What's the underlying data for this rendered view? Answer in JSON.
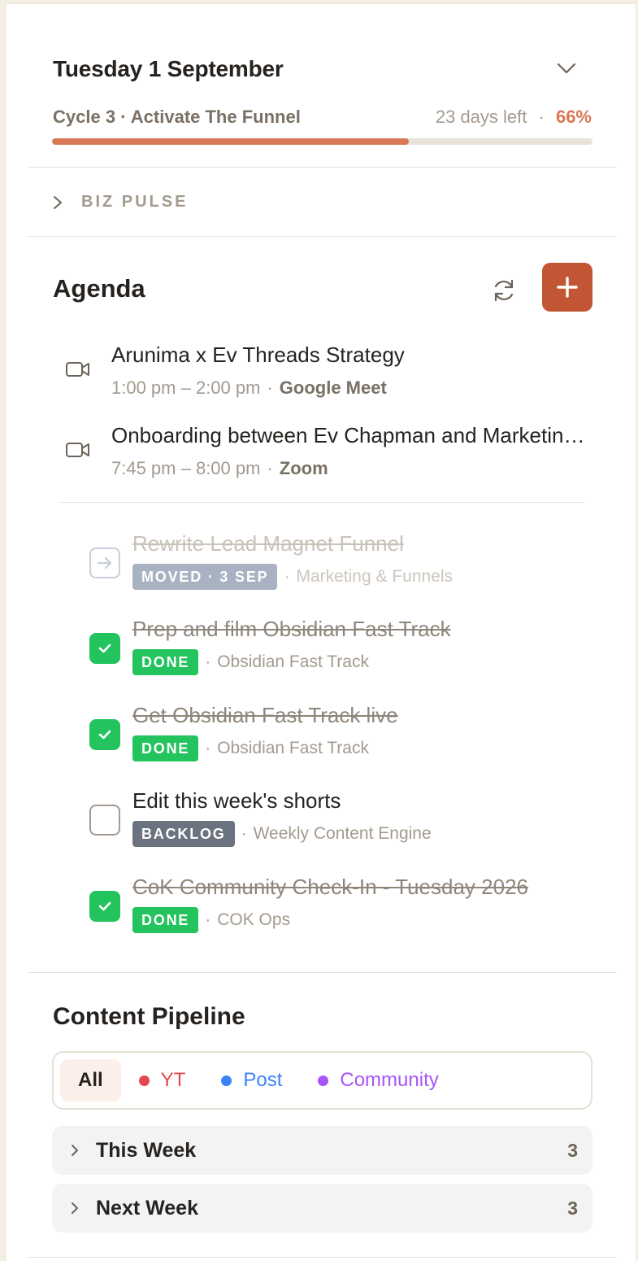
{
  "header": {
    "date": "Tuesday 1 September",
    "cycle_label": "Cycle 3 · Activate The Funnel",
    "days_left": "23 days left",
    "separator": "·",
    "percent": "66%",
    "progress_fraction": 0.66
  },
  "biz_pulse": {
    "label": "BIZ PULSE"
  },
  "agenda": {
    "title": "Agenda",
    "events": [
      {
        "title": "Arunima x Ev Threads Strategy",
        "time": "1:00 pm – 2:00 pm",
        "separator": "·",
        "location": "Google Meet"
      },
      {
        "title": "Onboarding between Ev Chapman and Marketing Team",
        "time": "7:45 pm – 8:00 pm",
        "separator": "·",
        "location": "Zoom"
      }
    ],
    "tasks": [
      {
        "title": "Rewrite Lead Magnet Funnel",
        "status": "MOVED · 3 SEP",
        "project": "Marketing & Funnels",
        "separator": "·"
      },
      {
        "title": "Prep and film Obsidian Fast Track",
        "status": "DONE",
        "project": "Obsidian Fast Track",
        "separator": "·"
      },
      {
        "title": "Get Obsidian Fast Track live",
        "status": "DONE",
        "project": "Obsidian Fast Track",
        "separator": "·"
      },
      {
        "title": "Edit this week's shorts",
        "status": "BACKLOG",
        "project": "Weekly Content Engine",
        "separator": "·"
      },
      {
        "title": "CoK Community Check-In - Tuesday 2026",
        "status": "DONE",
        "project": "COK Ops",
        "separator": "·"
      }
    ]
  },
  "content_pipeline": {
    "title": "Content Pipeline",
    "filters": [
      {
        "label": "All",
        "color": ""
      },
      {
        "label": "YT",
        "color": "#e5484d"
      },
      {
        "label": "Post",
        "color": "#3b82f6"
      },
      {
        "label": "Community",
        "color": "#a855f7"
      }
    ],
    "groups": [
      {
        "label": "This Week",
        "count": "3"
      },
      {
        "label": "Next Week",
        "count": "3"
      }
    ]
  },
  "colors": {
    "accent": "#c25634",
    "progress": "#d97a57",
    "done": "#23c35e",
    "backlog": "#6b7280",
    "moved": "#a8b2c2"
  },
  "icons": {
    "collapse": "chevron-down-icon",
    "biz_pulse": "chevron-right-icon",
    "sync": "refresh-icon",
    "add": "plus-icon",
    "event": "video-camera-icon",
    "done": "checkmark-icon",
    "moved": "arrow-right-icon"
  }
}
